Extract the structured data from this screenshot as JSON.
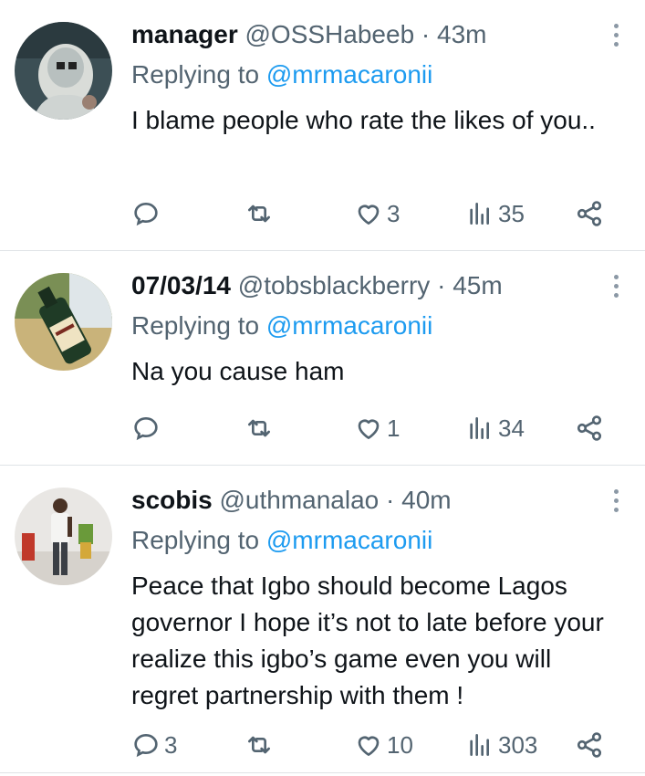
{
  "tweets": [
    {
      "name": "manager",
      "handle": "@OSSHabeeb",
      "time": "43m",
      "replying_prefix": "Replying to",
      "reply_to": "@mrmacaronii",
      "text": "I blame people who rate the likes of you..",
      "replies": "",
      "retweets": "",
      "likes": "3",
      "views": "35"
    },
    {
      "name": "07/03/14",
      "handle": "@tobsblackberry",
      "time": "45m",
      "replying_prefix": "Replying to",
      "reply_to": "@mrmacaronii",
      "text": "Na you cause ham",
      "replies": "",
      "retweets": "",
      "likes": "1",
      "views": "34"
    },
    {
      "name": "scobis",
      "handle": "@uthmanalao",
      "time": "40m",
      "replying_prefix": "Replying to",
      "reply_to": "@mrmacaronii",
      "text": "Peace that Igbo should become Lagos governor I hope it’s not to late before your realize this igbo’s game even you will regret partnership with them !",
      "replies": "3",
      "retweets": "",
      "likes": "10",
      "views": "303"
    }
  ],
  "separator": "·",
  "icons": [
    "reply-icon",
    "retweet-icon",
    "like-icon",
    "views-icon",
    "share-icon",
    "more-icon"
  ],
  "colors": {
    "link": "#1d9bf0",
    "muted": "#536471",
    "text": "#0f1419",
    "divider": "#dfe3e6"
  }
}
